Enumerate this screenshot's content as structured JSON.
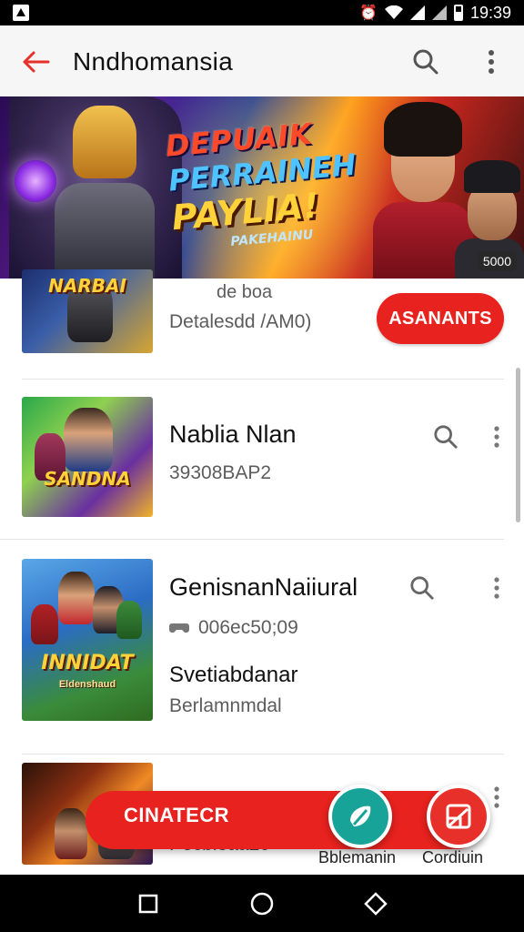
{
  "status_bar": {
    "time": "19:39"
  },
  "app_bar": {
    "title": "Nndhomansia"
  },
  "banner": {
    "headline_1": "DEPUAIK",
    "headline_2": "PERRAINEH",
    "headline_3": "PAYLIA!",
    "headline_4": "PAKEHAINU",
    "badge": "5000"
  },
  "list": [
    {
      "thumb_label": "NARBAI",
      "subtitle_1": "de boa",
      "subtitle_2": "Detalesdd /AM0)",
      "action_label": "ASANANTS"
    },
    {
      "thumb_label": "SANDNA",
      "title": "Nablia Nlan",
      "subtitle": "39308BAP2"
    },
    {
      "thumb_label": "INNIDAT",
      "thumb_sub": "Eldenshaud",
      "title": "GenisnanNaiiural",
      "meta": "006ec50;09",
      "label_1": "Svetiabdanar",
      "label_2": "Berlamnmdal"
    },
    {
      "title_partial": "",
      "subtitle": "Pecbieaa20"
    }
  ],
  "floating_bar": {
    "label": "CINATECR",
    "caption_left": "Bblemanin",
    "caption_right": "Cordiuin"
  }
}
